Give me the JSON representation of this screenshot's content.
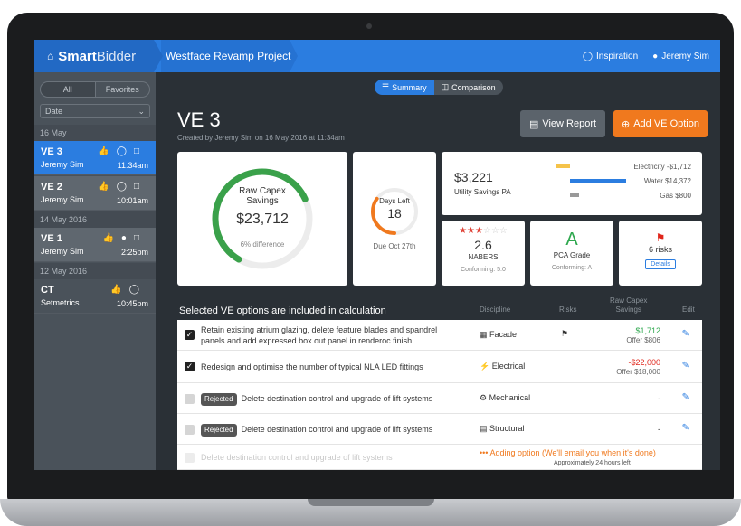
{
  "topbar": {
    "brand_bold": "Smart",
    "brand_thin": "Bidder",
    "project": "Westface Revamp Project",
    "inspiration": "Inspiration",
    "user": "Jeremy Sim"
  },
  "sidebar": {
    "seg_all": "All",
    "seg_favorites": "Favorites",
    "date_select": "Date",
    "groups": [
      "16 May",
      "14 May 2016",
      "12 May 2016"
    ],
    "items": [
      {
        "name": "VE 3",
        "by": "Jeremy Sim",
        "time": "11:34am"
      },
      {
        "name": "VE 2",
        "by": "Jeremy Sim",
        "time": "10:01am"
      },
      {
        "name": "VE 1",
        "by": "Jeremy Sim",
        "time": "2:25pm"
      },
      {
        "name": "CT",
        "by": "Setmetrics",
        "time": "10:45pm"
      }
    ]
  },
  "main": {
    "toggle_summary": "Summary",
    "toggle_comparison": "Comparison",
    "title": "VE 3",
    "subtitle": "Created by Jeremy Sim on 16 May 2016 at 11:34am",
    "view_report": "View Report",
    "add_option": "Add VE Option",
    "raw": {
      "label1": "Raw Capex",
      "label2": "Savings",
      "value": "$23,712",
      "diff": "6% difference",
      "progress": 0.72
    },
    "days": {
      "label": "Days Left",
      "value": "18",
      "due": "Due Oct 27th",
      "progress": 0.35
    },
    "utility": {
      "value": "$3,221",
      "label": "Utility Savings PA",
      "rows": [
        "Electricity -$1,712",
        "Water $14,372",
        "Gas $800"
      ]
    },
    "nabers": {
      "value": "2.6",
      "label": "NABERS",
      "conforming": "Conforming: 5.0",
      "stars": 2.5
    },
    "pca": {
      "grade": "A",
      "label": "PCA Grade",
      "conforming": "Conforming: A"
    },
    "risks": {
      "count": "6 risks",
      "details": "Details"
    },
    "table": {
      "title": "Selected VE options are included in calculation",
      "headers": {
        "discipline": "Discipline",
        "risks": "Risks",
        "savings1": "Raw Capex",
        "savings2": "Savings",
        "edit": "Edit"
      },
      "rows": [
        {
          "desc1": "Retain existing atrium glazing, delete feature blades and spandrel",
          "desc2": "panels and add expressed box out panel in renderoc finish",
          "discipline": "Facade",
          "saving": "$1,712",
          "offer": "Offer $806"
        },
        {
          "desc1": "Redesign and optimise the number of typical NLA LED fittings",
          "discipline": "Electrical",
          "saving": "-$22,000",
          "offer": "Offer $18,000"
        },
        {
          "rejected": "Rejected",
          "desc1": "Delete destination control and upgrade of lift systems",
          "discipline": "Mechanical",
          "saving": "-"
        },
        {
          "rejected": "Rejected",
          "desc1": "Delete destination control and upgrade of lift systems",
          "discipline": "Structural",
          "saving": "-"
        },
        {
          "desc1": "Delete destination control and upgrade of lift systems",
          "adding": "Adding option (We'll email you when it's done)",
          "adding_sub": "Approximately 24 hours left"
        }
      ]
    }
  },
  "colors": {
    "accent": "#2b7de0",
    "orange": "#f0791e",
    "green": "#2fa84f",
    "red": "#e0261b"
  }
}
